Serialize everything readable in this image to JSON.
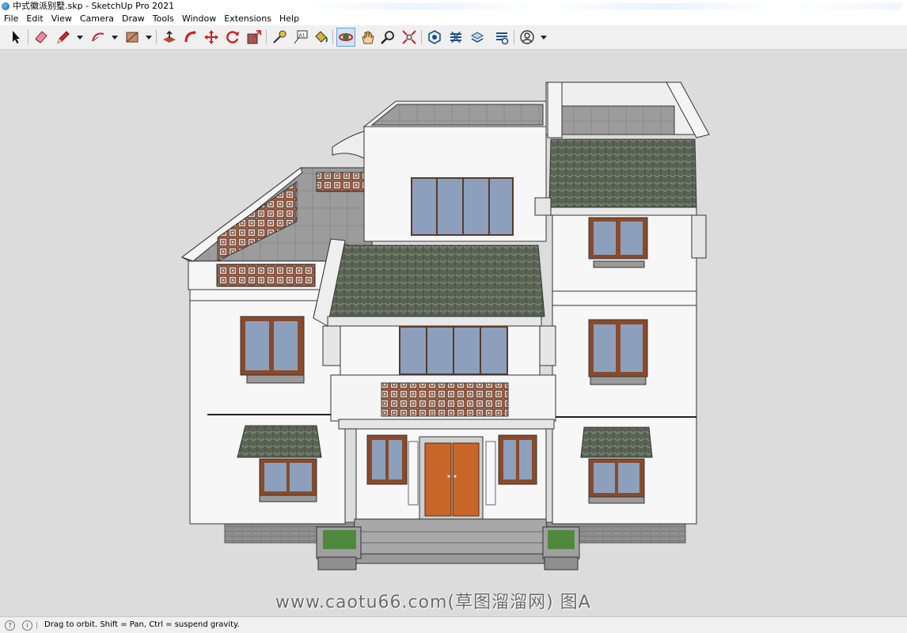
{
  "window": {
    "title": "中式徽派别墅.skp - SketchUp Pro 2021"
  },
  "menu": {
    "items": [
      "File",
      "Edit",
      "View",
      "Camera",
      "Draw",
      "Tools",
      "Window",
      "Extensions",
      "Help"
    ]
  },
  "toolbar": {
    "tools": [
      "select-icon",
      "eraser-icon",
      "pencil-line-icon",
      "arc-icon",
      "rectangle-icon",
      "push-pull-icon",
      "follow-me-icon",
      "move-icon",
      "rotate-icon",
      "scale-icon",
      "tape-measure-icon",
      "text-icon",
      "paint-bucket-icon",
      "orbit-icon",
      "pan-icon",
      "zoom-icon",
      "zoom-extents-icon",
      "warehouse-icon",
      "extension-warehouse-icon",
      "layout-icon",
      "extension-manager-icon",
      "account-icon"
    ],
    "active_tool": "orbit-icon"
  },
  "viewport": {
    "background": "#dcdcdc",
    "watermark": "www.caotu66.com(草图溜溜网) 图A"
  },
  "status": {
    "text": "Drag to orbit. Shift = Pan, Ctrl = suspend gravity."
  },
  "colors": {
    "wall": "#f7f7f7",
    "roof_tile": "#5b6455",
    "wood": "#8a4a2a",
    "glass": "#8ca0bd",
    "door": "#c8662a",
    "plinth": "#8d8d8d",
    "grass": "#4f8a3c"
  }
}
